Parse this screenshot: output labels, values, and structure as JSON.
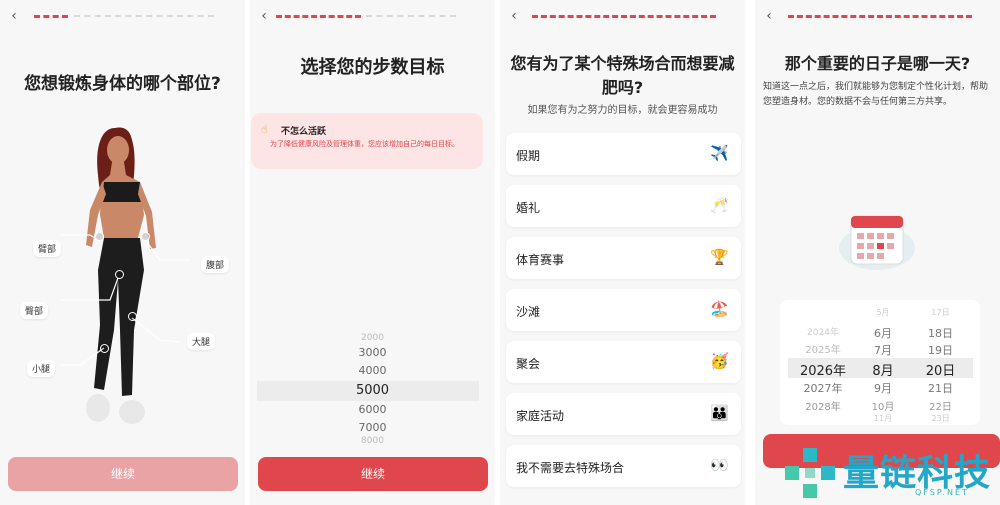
{
  "screens": [
    {
      "title": "您想锻炼身体的哪个部位?",
      "back_icon": "chevron-left",
      "continue_label": "继续",
      "button_color": "#e9a3a5",
      "body_parts": [
        "臂部",
        "腹部",
        "臀部",
        "大腿",
        "小腿"
      ]
    },
    {
      "title": "选择您的步数目标",
      "back_icon": "chevron-left",
      "hint_title": "不怎么活跃",
      "hint_desc": "为了降低健康风险及管理体重，您应该增加自己的每日目标。",
      "picker": [
        "2000",
        "3000",
        "4000",
        "5000",
        "6000",
        "7000",
        "8000"
      ],
      "picker_selected": "5000",
      "continue_label": "继续",
      "button_color": "#e0474c"
    },
    {
      "title": "您有为了某个特殊场合而想要减肥吗?",
      "subtitle": "如果您有为之努力的目标，就会更容易成功",
      "back_icon": "chevron-left",
      "options": [
        {
          "label": "假期",
          "emoji": "✈️"
        },
        {
          "label": "婚礼",
          "emoji": "🥂"
        },
        {
          "label": "体育赛事",
          "emoji": "🏆"
        },
        {
          "label": "沙滩",
          "emoji": "🏖️"
        },
        {
          "label": "聚会",
          "emoji": "🥳"
        },
        {
          "label": "家庭活动",
          "emoji": "👪"
        },
        {
          "label": "我不需要去特殊场合",
          "emoji": "👀"
        }
      ]
    },
    {
      "title": "那个重要的日子是哪一天?",
      "description": "知道这一点之后，我们就能够为您制定个性化计划，帮助您塑造身材。您的数据不会与任何第三方共享。",
      "back_icon": "chevron-left",
      "years": [
        "2024年",
        "2025年",
        "2026年",
        "2027年",
        "2028年"
      ],
      "months": [
        "5月",
        "6月",
        "7月",
        "8月",
        "9月",
        "10月",
        "11月"
      ],
      "days": [
        "17日",
        "18日",
        "19日",
        "20日",
        "21日",
        "22日",
        "23日"
      ],
      "selected": {
        "year": "2026年",
        "month": "8月",
        "day": "20日"
      }
    }
  ],
  "watermark": {
    "text": "量链科技",
    "sub": "QFSP.NET"
  },
  "colors": {
    "accent": "#e0474c",
    "panel_bg": "#f7f7f7"
  }
}
